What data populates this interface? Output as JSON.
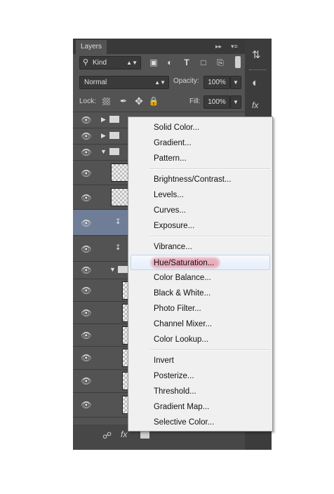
{
  "panel": {
    "tab_label": "Layers",
    "filter": {
      "label": "Kind",
      "icon": "search-icon"
    },
    "blend_mode": "Normal",
    "opacity_label": "Opacity:",
    "opacity_value": "100%",
    "lock_label": "Lock:",
    "fill_label": "Fill:",
    "fill_value": "100%",
    "filter_icons": [
      "image-filter-icon",
      "adjustment-filter-icon",
      "type-filter-icon",
      "shape-filter-icon",
      "smart-object-filter-icon"
    ],
    "lock_icons": [
      "lock-transparent-icon",
      "lock-image-icon",
      "lock-position-icon",
      "lock-all-icon"
    ],
    "layers": [
      {
        "kind": "group",
        "expanded": false
      },
      {
        "kind": "group",
        "expanded": false
      },
      {
        "kind": "group",
        "expanded": true
      },
      {
        "kind": "pixel"
      },
      {
        "kind": "pixel"
      },
      {
        "kind": "adjustment",
        "clipped": true,
        "selected": true
      },
      {
        "kind": "adjustment",
        "clipped": true
      },
      {
        "kind": "group",
        "expanded": true
      },
      {
        "kind": "pixel"
      },
      {
        "kind": "pixel"
      },
      {
        "kind": "pixel"
      },
      {
        "kind": "pixel"
      },
      {
        "kind": "pixel"
      },
      {
        "kind": "pixel"
      }
    ],
    "bottom_icons": [
      "link-icon",
      "fx-icon",
      "mask-icon",
      "adjustment-icon",
      "folder-icon",
      "new-layer-icon",
      "trash-icon"
    ],
    "fx_label": "fx"
  },
  "context_menu": {
    "groups": [
      [
        "Solid Color...",
        "Gradient...",
        "Pattern..."
      ],
      [
        "Brightness/Contrast...",
        "Levels...",
        "Curves...",
        "Exposure..."
      ],
      [
        "Vibrance...",
        "Hue/Saturation...",
        "Color Balance...",
        "Black & White...",
        "Photo Filter...",
        "Channel Mixer...",
        "Color Lookup..."
      ],
      [
        "Invert",
        "Posterize...",
        "Threshold...",
        "Gradient Map...",
        "Selective Color..."
      ]
    ],
    "highlighted": "Hue/Saturation..."
  },
  "colors": {
    "panel": "#535353",
    "menu": "#f0f0f0",
    "highlight_mark": "#e65a6e"
  }
}
